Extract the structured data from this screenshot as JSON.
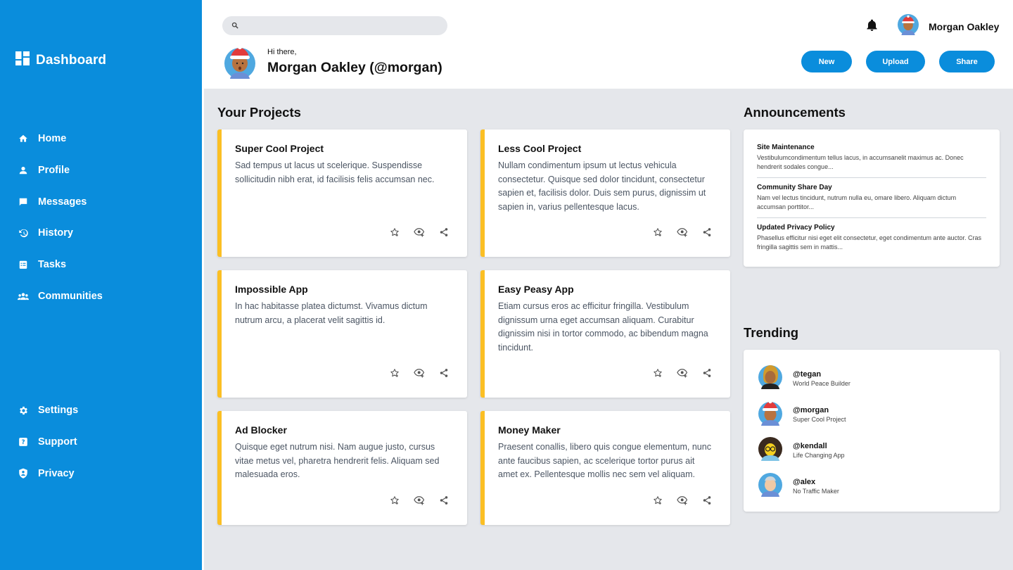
{
  "sidebar": {
    "brand": "Dashboard",
    "nav_top": [
      {
        "label": "Home",
        "icon": "home-icon"
      },
      {
        "label": "Profile",
        "icon": "person-icon"
      },
      {
        "label": "Messages",
        "icon": "message-icon"
      },
      {
        "label": "History",
        "icon": "history-icon"
      },
      {
        "label": "Tasks",
        "icon": "clipboard-icon"
      },
      {
        "label": "Communities",
        "icon": "group-icon"
      }
    ],
    "nav_bottom": [
      {
        "label": "Settings",
        "icon": "gear-icon"
      },
      {
        "label": "Support",
        "icon": "help-icon"
      },
      {
        "label": "Privacy",
        "icon": "shield-icon"
      }
    ]
  },
  "header": {
    "search_placeholder": "",
    "user_name": "Morgan Oakley",
    "greeting": "Hi there,",
    "full_name": "Morgan Oakley (@morgan)",
    "buttons": {
      "new": "New",
      "upload": "Upload",
      "share": "Share"
    }
  },
  "projects": {
    "title": "Your Projects",
    "items": [
      {
        "title": "Super Cool Project",
        "desc": "Sad tempus ut lacus ut scelerique. Suspendisse sollicitudin nibh erat, id facilisis felis accumsan nec."
      },
      {
        "title": "Less Cool Project",
        "desc": "Nullam condimentum ipsum ut lectus vehicula consectetur. Quisque sed dolor tincidunt, consectetur sapien et, facilisis dolor. Duis sem purus, dignissim ut sapien in, varius pellentesque lacus."
      },
      {
        "title": "Impossible App",
        "desc": "In hac habitasse platea dictumst. Vivamus dictum nutrum arcu, a placerat velit sagittis id."
      },
      {
        "title": "Easy Peasy App",
        "desc": "Etiam cursus eros ac efficitur fringilla. Vestibulum dignissum urna eget accumsan aliquam. Curabitur dignissim nisi in tortor commodo, ac bibendum magna tincidunt."
      },
      {
        "title": "Ad Blocker",
        "desc": "Quisque eget nutrum nisi. Nam augue justo, cursus vitae metus vel, pharetra hendrerit felis. Aliquam sed malesuada eros."
      },
      {
        "title": "Money Maker",
        "desc": "Praesent conallis, libero quis congue elementum, nunc ante faucibus sapien, ac scelerique tortor purus ait amet ex. Pellentesque mollis nec sem vel aliquam."
      }
    ]
  },
  "announcements": {
    "title": "Announcements",
    "items": [
      {
        "title": "Site Maintenance",
        "text": "Vestibulumcondimentum tellus lacus, in accumsanelit maximus ac. Donec hendrerit sodales congue..."
      },
      {
        "title": "Community Share Day",
        "text": "Nam vel lectus tincidunt, nutrum nulla eu, omare libero. Aliquam dictum accumsan porttitor..."
      },
      {
        "title": "Updated Privacy Policy",
        "text": "Phasellus efficitur nisi eget elit consectetur, eget condimentum ante auctor. Cras fringilla sagittis sem in mattis..."
      }
    ]
  },
  "trending": {
    "title": "Trending",
    "items": [
      {
        "handle": "@tegan",
        "sub": "World Peace Builder"
      },
      {
        "handle": "@morgan",
        "sub": "Super Cool Project"
      },
      {
        "handle": "@kendall",
        "sub": "Life Changing App"
      },
      {
        "handle": "@alex",
        "sub": "No Traffic Maker"
      }
    ]
  },
  "colors": {
    "accent": "#0a8ddc",
    "card_stripe": "#fbbf24",
    "background": "#e5e7eb"
  }
}
